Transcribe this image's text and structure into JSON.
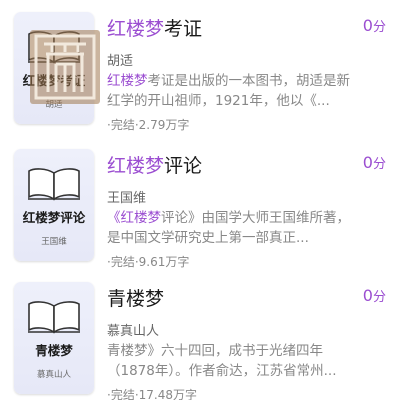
{
  "accent_color": "#9b4ed1",
  "books": [
    {
      "title_highlight": "红楼梦",
      "title_rest": "考证",
      "author": "胡适",
      "score_number": "0",
      "score_unit": "分",
      "desc_highlight": "红楼梦",
      "desc_rest": "考证是出版的一本图书，胡适是新红学的开山祖师，1921年，他以《...",
      "meta": "·完结·2.79万字",
      "cover_title": "红楼梦考证",
      "cover_author": "胡适"
    },
    {
      "title_highlight": "红楼梦",
      "title_rest": "评论",
      "author": "王国维",
      "score_number": "0",
      "score_unit": "分",
      "desc_pre": "《",
      "desc_highlight": "红楼梦",
      "desc_rest": "评论》由国学大师王国维所著，是中国文学研究史上第一部真正...",
      "meta": "·完结·9.61万字",
      "cover_title": "红楼梦评论",
      "cover_author": "王国维"
    },
    {
      "title": "青楼梦",
      "author": "慕真山人",
      "score_number": "0",
      "score_unit": "分",
      "desc": "青楼梦》六十四回，成书于光绪四年（1878年）。作者俞达，江苏省常州...",
      "meta": "·完结·17.48万字",
      "cover_title": "青楼梦",
      "cover_author": "慕真山人"
    }
  ]
}
